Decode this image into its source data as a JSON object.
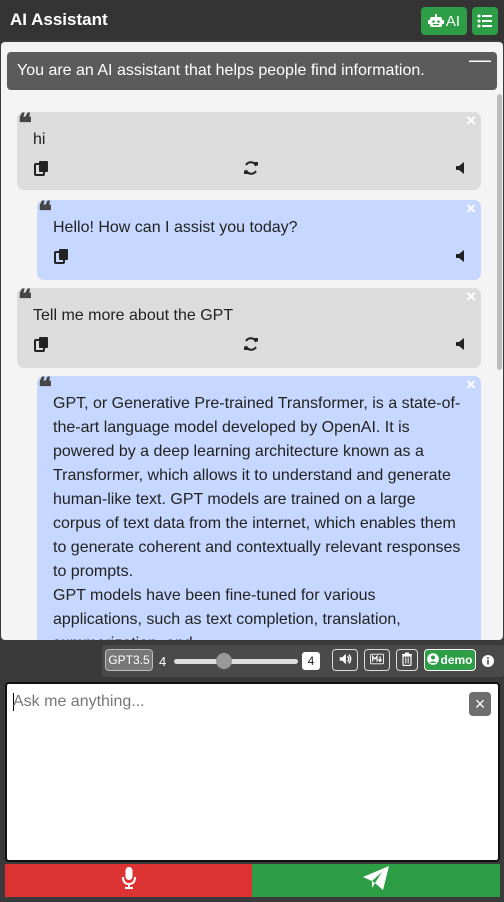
{
  "header": {
    "title": "AI Assistant",
    "ai_button_label": "AI",
    "ai_button_icon": "robot-icon",
    "menu_button_icon": "list-icon"
  },
  "system_prompt": {
    "text": "You are an AI assistant that helps people find information.",
    "collapse_icon": "minus-icon"
  },
  "messages": [
    {
      "role": "user",
      "quote_glyph": "❝",
      "close_glyph": "×",
      "text": "hi"
    },
    {
      "role": "assistant",
      "quote_glyph": "❝",
      "close_glyph": "×",
      "text": "Hello! How can I assist you today?"
    },
    {
      "role": "user",
      "quote_glyph": "❝",
      "close_glyph": "×",
      "text": "Tell me more about the GPT"
    },
    {
      "role": "assistant",
      "quote_glyph": "❝",
      "close_glyph": "×",
      "text": "GPT, or Generative Pre-trained Transformer, is a state-of-the-art language model developed by OpenAI. It is powered by a deep learning architecture known as a Transformer, which allows it to understand and generate human-like text. GPT models are trained on a large corpus of text data from the internet, which enables them to generate coherent and contextually relevant responses to prompts.\nGPT models have been fine-tuned for various applications, such as text completion, translation, summarization, and"
    }
  ],
  "message_actions": {
    "copy_icon": "copy-icon",
    "regenerate_icon": "refresh-icon",
    "speak_icon": "speaker-icon"
  },
  "controls": {
    "model_label": "GPT3.5",
    "context_min": "4",
    "context_value": "4",
    "context_fraction": 0.4,
    "voice_icon": "volume-icon",
    "markdown_icon": "markdown-icon",
    "delete_icon": "trash-icon",
    "user_label": "demo",
    "user_icon": "user-circle-icon",
    "info_icon": "info-icon"
  },
  "input": {
    "placeholder": "Ask me anything...",
    "value": "",
    "clear_glyph": "×"
  },
  "footer": {
    "mic_icon": "microphone-icon",
    "send_icon": "send-icon"
  },
  "colors": {
    "user_bubble": "#dcdcdc",
    "assistant_bubble": "#c6d8ff",
    "accent_green": "#2e9e46",
    "mic_red": "#dd3333"
  }
}
